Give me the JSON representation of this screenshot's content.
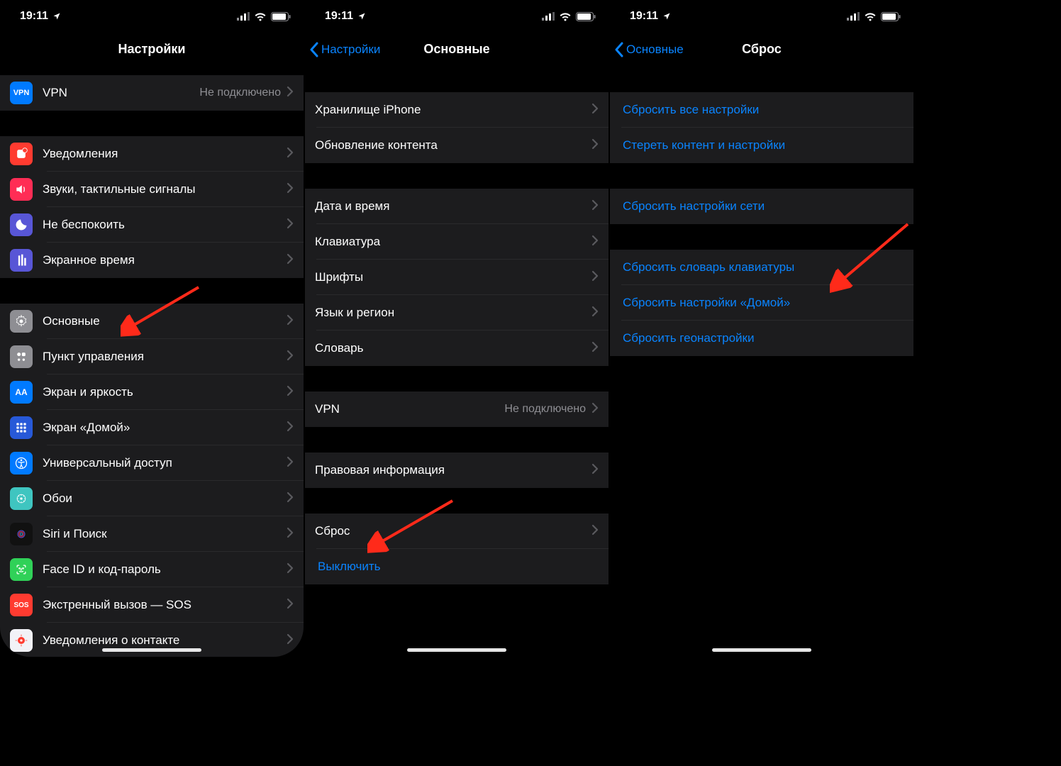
{
  "status": {
    "time": "19:11"
  },
  "panel1": {
    "title": "Настройки",
    "rows": {
      "vpn": {
        "label": "VPN",
        "detail": "Не подключено"
      },
      "notifications": {
        "label": "Уведомления"
      },
      "sounds": {
        "label": "Звуки, тактильные сигналы"
      },
      "dnd": {
        "label": "Не беспокоить"
      },
      "screentime": {
        "label": "Экранное время"
      },
      "general": {
        "label": "Основные"
      },
      "control": {
        "label": "Пункт управления"
      },
      "display": {
        "label": "Экран и яркость"
      },
      "home": {
        "label": "Экран «Домой»"
      },
      "accessibility": {
        "label": "Универсальный доступ"
      },
      "wallpaper": {
        "label": "Обои"
      },
      "siri": {
        "label": "Siri и Поиск"
      },
      "faceid": {
        "label": "Face ID и код-пароль"
      },
      "sos": {
        "label": "Экстренный вызов — SOS"
      },
      "exposure": {
        "label": "Уведомления о контакте"
      }
    }
  },
  "panel2": {
    "back": "Настройки",
    "title": "Основные",
    "rows": {
      "storage": "Хранилище iPhone",
      "bgrefresh": "Обновление контента",
      "datetime": "Дата и время",
      "keyboard": "Клавиатура",
      "fonts": "Шрифты",
      "language": "Язык и регион",
      "dictionary": "Словарь",
      "vpn_label": "VPN",
      "vpn_detail": "Не подключено",
      "legal": "Правовая информация",
      "reset": "Сброс",
      "shutdown": "Выключить"
    }
  },
  "panel3": {
    "back": "Основные",
    "title": "Сброс",
    "links": {
      "all": "Сбросить все настройки",
      "erase": "Стереть контент и настройки",
      "network": "Сбросить настройки сети",
      "kbdict": "Сбросить словарь клавиатуры",
      "home": "Сбросить настройки «Домой»",
      "geo": "Сбросить геонастройки"
    }
  }
}
